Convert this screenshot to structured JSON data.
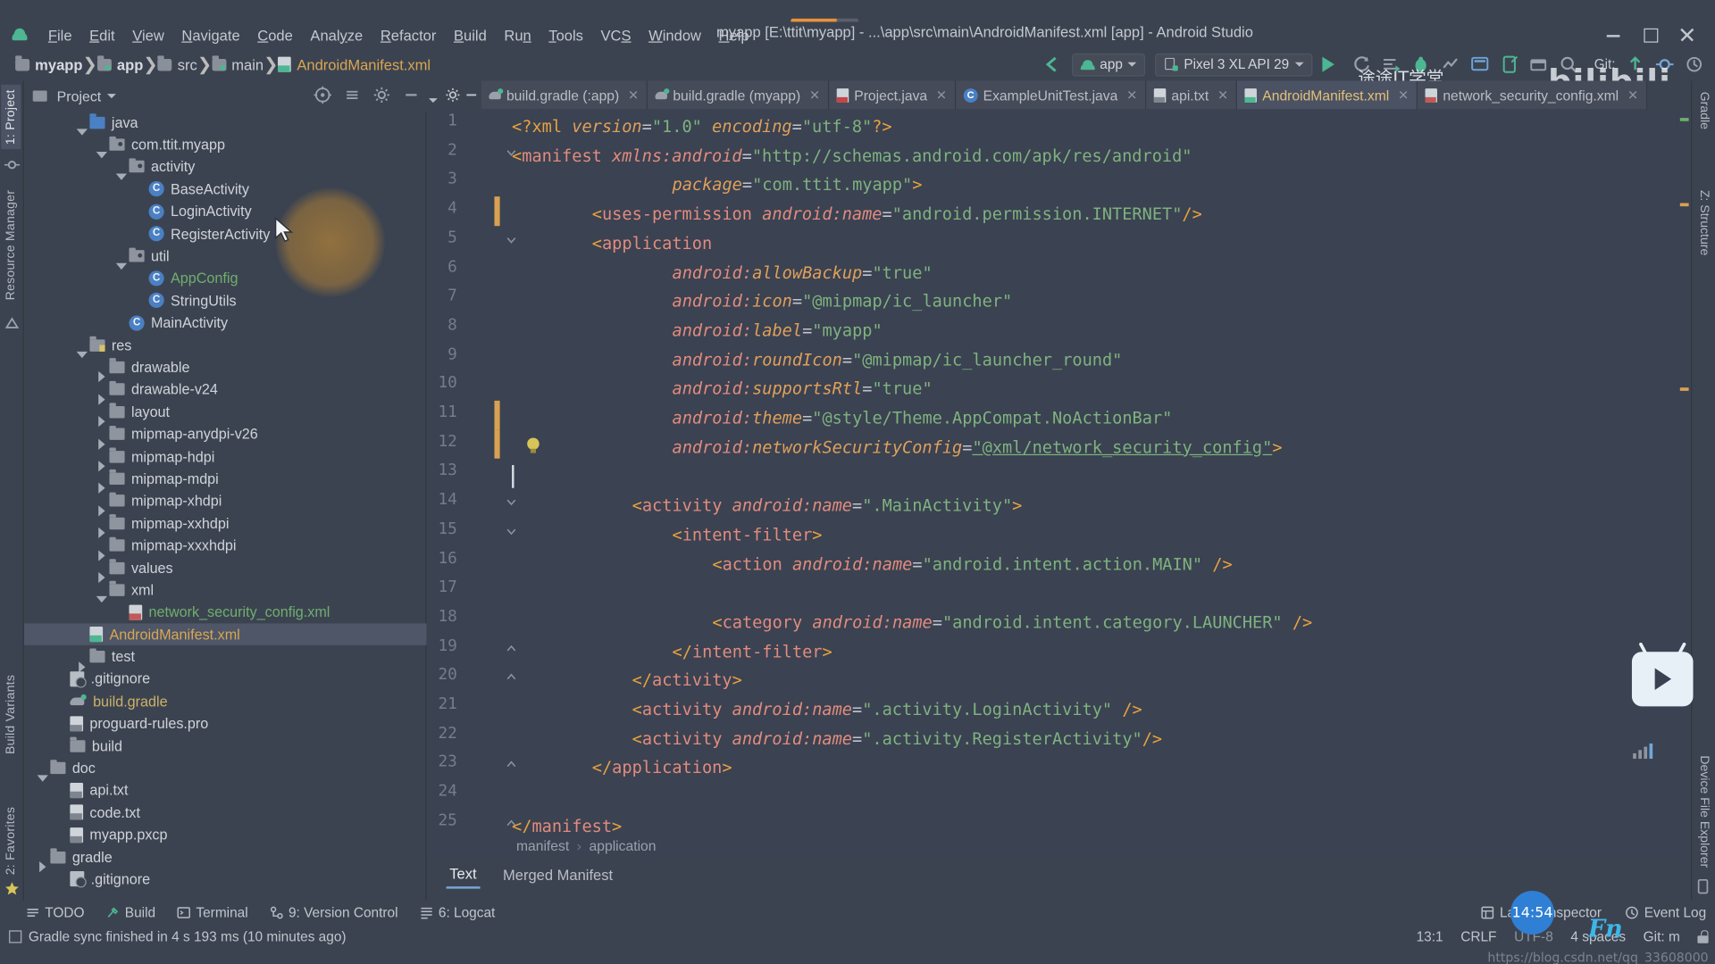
{
  "window": {
    "title": "myapp [E:\\ttit\\myapp] - ...\\app\\src\\main\\AndroidManifest.xml [app] - Android Studio",
    "minimize_label": "Minimize",
    "maximize_label": "Maximize",
    "close_label": "Close"
  },
  "menu": {
    "items": [
      {
        "label": "File"
      },
      {
        "label": "Edit"
      },
      {
        "label": "View"
      },
      {
        "label": "Navigate"
      },
      {
        "label": "Code"
      },
      {
        "label": "Analyze"
      },
      {
        "label": "Refactor"
      },
      {
        "label": "Build"
      },
      {
        "label": "Run"
      },
      {
        "label": "Tools"
      },
      {
        "label": "VCS"
      },
      {
        "label": "Window"
      },
      {
        "label": "Help"
      }
    ]
  },
  "navbar": {
    "crumbs": [
      "myapp",
      "app",
      "src",
      "main",
      "AndroidManifest.xml"
    ],
    "run_config": "app",
    "device": "Pixel 3 XL API 29",
    "git_label": "Git:"
  },
  "watermark": {
    "brand": "bilibili",
    "channel": "途途IT学堂",
    "blog": "https://blog.csdn.net/qq_33608000"
  },
  "left_strip": {
    "project_tab": "1: Project",
    "resource_manager": "Resource Manager",
    "structure": "2: Structure",
    "favorites": "2: Favorites",
    "build_variants": "Build Variants"
  },
  "right_strip": {
    "gradle": "Gradle",
    "structure": "Z: Structure",
    "device_file_explorer": "Device File Explorer"
  },
  "project_panel": {
    "title": "Project",
    "tree": [
      {
        "depth": 2,
        "arrow": "down",
        "icon": "folder-blue",
        "label": "java",
        "color": "white"
      },
      {
        "depth": 3,
        "arrow": "down",
        "icon": "package",
        "label": "com.ttit.myapp",
        "color": "white"
      },
      {
        "depth": 4,
        "arrow": "down",
        "icon": "package",
        "label": "activity",
        "color": "white"
      },
      {
        "depth": 5,
        "arrow": "none",
        "icon": "class",
        "label": "BaseActivity",
        "color": "white"
      },
      {
        "depth": 5,
        "arrow": "none",
        "icon": "class",
        "label": "LoginActivity",
        "color": "white"
      },
      {
        "depth": 5,
        "arrow": "none",
        "icon": "class",
        "label": "RegisterActivity",
        "color": "white"
      },
      {
        "depth": 4,
        "arrow": "down",
        "icon": "package",
        "label": "util",
        "color": "white"
      },
      {
        "depth": 5,
        "arrow": "none",
        "icon": "class",
        "label": "AppConfig",
        "color": "green"
      },
      {
        "depth": 5,
        "arrow": "none",
        "icon": "class",
        "label": "StringUtils",
        "color": "white"
      },
      {
        "depth": 4,
        "arrow": "none",
        "icon": "class",
        "label": "MainActivity",
        "color": "white"
      },
      {
        "depth": 2,
        "arrow": "down",
        "icon": "folder-res",
        "label": "res",
        "color": "white"
      },
      {
        "depth": 3,
        "arrow": "right",
        "icon": "folder",
        "label": "drawable",
        "color": "white"
      },
      {
        "depth": 3,
        "arrow": "right",
        "icon": "folder",
        "label": "drawable-v24",
        "color": "white"
      },
      {
        "depth": 3,
        "arrow": "right",
        "icon": "folder",
        "label": "layout",
        "color": "white"
      },
      {
        "depth": 3,
        "arrow": "right",
        "icon": "folder",
        "label": "mipmap-anydpi-v26",
        "color": "white"
      },
      {
        "depth": 3,
        "arrow": "right",
        "icon": "folder",
        "label": "mipmap-hdpi",
        "color": "white"
      },
      {
        "depth": 3,
        "arrow": "right",
        "icon": "folder",
        "label": "mipmap-mdpi",
        "color": "white"
      },
      {
        "depth": 3,
        "arrow": "right",
        "icon": "folder",
        "label": "mipmap-xhdpi",
        "color": "white"
      },
      {
        "depth": 3,
        "arrow": "right",
        "icon": "folder",
        "label": "mipmap-xxhdpi",
        "color": "white"
      },
      {
        "depth": 3,
        "arrow": "right",
        "icon": "folder",
        "label": "mipmap-xxxhdpi",
        "color": "white"
      },
      {
        "depth": 3,
        "arrow": "right",
        "icon": "folder",
        "label": "values",
        "color": "white"
      },
      {
        "depth": 3,
        "arrow": "down",
        "icon": "folder",
        "label": "xml",
        "color": "white"
      },
      {
        "depth": 4,
        "arrow": "none",
        "icon": "file-xml",
        "label": "network_security_config.xml",
        "color": "green"
      },
      {
        "depth": 2,
        "arrow": "none",
        "icon": "file-mf",
        "label": "AndroidManifest.xml",
        "color": "orange",
        "selected": true
      },
      {
        "depth": 2,
        "arrow": "right",
        "icon": "folder",
        "label": "test",
        "color": "white"
      },
      {
        "depth": 1,
        "arrow": "none",
        "icon": "gitignore",
        "label": ".gitignore",
        "color": "white"
      },
      {
        "depth": 1,
        "arrow": "none",
        "icon": "gradle",
        "label": "build.gradle",
        "color": "yellow"
      },
      {
        "depth": 1,
        "arrow": "none",
        "icon": "file-txt",
        "label": "proguard-rules.pro",
        "color": "white"
      },
      {
        "depth": 1,
        "arrow": "none",
        "icon": "folder",
        "label": "build",
        "color": "white"
      },
      {
        "depth": 0,
        "arrow": "down",
        "icon": "folder",
        "label": "doc",
        "color": "white"
      },
      {
        "depth": 1,
        "arrow": "none",
        "icon": "file-txt",
        "label": "api.txt",
        "color": "white"
      },
      {
        "depth": 1,
        "arrow": "none",
        "icon": "file-txt",
        "label": "code.txt",
        "color": "white"
      },
      {
        "depth": 1,
        "arrow": "none",
        "icon": "file-txt",
        "label": "myapp.pxcp",
        "color": "white"
      },
      {
        "depth": 0,
        "arrow": "right",
        "icon": "folder",
        "label": "gradle",
        "color": "white"
      },
      {
        "depth": 1,
        "arrow": "none",
        "icon": "gitignore",
        "label": ".gitignore",
        "color": "white"
      }
    ]
  },
  "editor_tabs": [
    {
      "label": "build.gradle (:app)",
      "icon": "gradle",
      "active": false,
      "closable": true
    },
    {
      "label": "build.gradle (myapp)",
      "icon": "gradle",
      "active": false,
      "closable": true
    },
    {
      "label": "Project.java",
      "icon": "java",
      "active": false,
      "closable": true
    },
    {
      "label": "ExampleUnitTest.java",
      "icon": "test",
      "active": false,
      "closable": true
    },
    {
      "label": "api.txt",
      "icon": "txt",
      "active": false,
      "closable": true
    },
    {
      "label": "AndroidManifest.xml",
      "icon": "mf",
      "active": true,
      "closable": true
    },
    {
      "label": "network_security_config.xml",
      "icon": "xmlred",
      "active": false,
      "closable": true
    }
  ],
  "editor": {
    "lines": [
      {
        "n": 1,
        "indent": 0,
        "tokens": [
          {
            "t": "tag",
            "v": "<?xml "
          },
          {
            "t": "attr",
            "v": "version"
          },
          {
            "t": "eq",
            "v": "="
          },
          {
            "t": "str",
            "v": "\"1.0\""
          },
          {
            "t": "plain",
            "v": " "
          },
          {
            "t": "attr",
            "v": "encoding"
          },
          {
            "t": "eq",
            "v": "="
          },
          {
            "t": "str",
            "v": "\"utf-8\""
          },
          {
            "t": "tag",
            "v": "?>"
          }
        ]
      },
      {
        "n": 2,
        "indent": 0,
        "fold": "down",
        "tokens": [
          {
            "t": "tag",
            "v": "<"
          },
          {
            "t": "elem",
            "v": "manifest"
          },
          {
            "t": "plain",
            "v": " "
          },
          {
            "t": "ns",
            "v": "xmlns:android"
          },
          {
            "t": "eq",
            "v": "="
          },
          {
            "t": "str",
            "v": "\"http://schemas.android.com/apk/res/android\""
          }
        ]
      },
      {
        "n": 3,
        "indent": 4,
        "tokens": [
          {
            "t": "attr",
            "v": "package"
          },
          {
            "t": "eq",
            "v": "="
          },
          {
            "t": "str",
            "v": "\"com.ttit.myapp\""
          },
          {
            "t": "tag",
            "v": ">"
          }
        ]
      },
      {
        "n": 4,
        "indent": 2,
        "change": true,
        "tokens": [
          {
            "t": "tag",
            "v": "<"
          },
          {
            "t": "elem",
            "v": "uses-permission"
          },
          {
            "t": "plain",
            "v": " "
          },
          {
            "t": "ns",
            "v": "android:name"
          },
          {
            "t": "eq",
            "v": "="
          },
          {
            "t": "str",
            "v": "\"android.permission.INTERNET\""
          },
          {
            "t": "tag",
            "v": "/>"
          }
        ]
      },
      {
        "n": 5,
        "indent": 2,
        "fold": "down",
        "tokens": [
          {
            "t": "tag",
            "v": "<"
          },
          {
            "t": "elem",
            "v": "application"
          }
        ]
      },
      {
        "n": 6,
        "indent": 4,
        "tokens": [
          {
            "t": "ns",
            "v": "android:"
          },
          {
            "t": "attr",
            "v": "allowBackup"
          },
          {
            "t": "eq",
            "v": "="
          },
          {
            "t": "str",
            "v": "\"true\""
          }
        ]
      },
      {
        "n": 7,
        "indent": 4,
        "tokens": [
          {
            "t": "ns",
            "v": "android:"
          },
          {
            "t": "attr",
            "v": "icon"
          },
          {
            "t": "eq",
            "v": "="
          },
          {
            "t": "str",
            "v": "\"@mipmap/ic_launcher\""
          }
        ]
      },
      {
        "n": 8,
        "indent": 4,
        "tokens": [
          {
            "t": "ns",
            "v": "android:"
          },
          {
            "t": "attr",
            "v": "label"
          },
          {
            "t": "eq",
            "v": "="
          },
          {
            "t": "str",
            "v": "\"myapp\""
          }
        ]
      },
      {
        "n": 9,
        "indent": 4,
        "tokens": [
          {
            "t": "ns",
            "v": "android:"
          },
          {
            "t": "attr",
            "v": "roundIcon"
          },
          {
            "t": "eq",
            "v": "="
          },
          {
            "t": "str",
            "v": "\"@mipmap/ic_launcher_round\""
          }
        ]
      },
      {
        "n": 10,
        "indent": 4,
        "tokens": [
          {
            "t": "ns",
            "v": "android:"
          },
          {
            "t": "attr",
            "v": "supportsRtl"
          },
          {
            "t": "eq",
            "v": "="
          },
          {
            "t": "str",
            "v": "\"true\""
          }
        ]
      },
      {
        "n": 11,
        "indent": 4,
        "change": true,
        "tokens": [
          {
            "t": "ns",
            "v": "android:"
          },
          {
            "t": "attr",
            "v": "theme"
          },
          {
            "t": "eq",
            "v": "="
          },
          {
            "t": "str",
            "v": "\"@style/Theme.AppCompat.NoActionBar\""
          }
        ]
      },
      {
        "n": 12,
        "indent": 4,
        "change": true,
        "bulb": true,
        "tokens": [
          {
            "t": "ns",
            "v": "android:"
          },
          {
            "t": "attr",
            "v": "networkSecurityConfig"
          },
          {
            "t": "eq",
            "v": "="
          },
          {
            "t": "strul",
            "v": "\"@xml/network_security_config\""
          },
          {
            "t": "tag",
            "v": ">"
          }
        ]
      },
      {
        "n": 13,
        "indent": 0,
        "caret": true,
        "tokens": []
      },
      {
        "n": 14,
        "indent": 3,
        "fold": "down",
        "tokens": [
          {
            "t": "tag",
            "v": "<"
          },
          {
            "t": "elem",
            "v": "activity"
          },
          {
            "t": "plain",
            "v": " "
          },
          {
            "t": "ns",
            "v": "android:name"
          },
          {
            "t": "eq",
            "v": "="
          },
          {
            "t": "str",
            "v": "\".MainActivity\""
          },
          {
            "t": "tag",
            "v": ">"
          }
        ]
      },
      {
        "n": 15,
        "indent": 4,
        "fold": "down",
        "tokens": [
          {
            "t": "tag",
            "v": "<"
          },
          {
            "t": "elem",
            "v": "intent-filter"
          },
          {
            "t": "tag",
            "v": ">"
          }
        ]
      },
      {
        "n": 16,
        "indent": 5,
        "tokens": [
          {
            "t": "tag",
            "v": "<"
          },
          {
            "t": "elem",
            "v": "action"
          },
          {
            "t": "plain",
            "v": " "
          },
          {
            "t": "ns",
            "v": "android:name"
          },
          {
            "t": "eq",
            "v": "="
          },
          {
            "t": "str",
            "v": "\"android.intent.action.MAIN\""
          },
          {
            "t": "tag",
            "v": " />"
          }
        ]
      },
      {
        "n": 17,
        "indent": 0,
        "tokens": []
      },
      {
        "n": 18,
        "indent": 5,
        "tokens": [
          {
            "t": "tag",
            "v": "<"
          },
          {
            "t": "elem",
            "v": "category"
          },
          {
            "t": "plain",
            "v": " "
          },
          {
            "t": "ns",
            "v": "android:name"
          },
          {
            "t": "eq",
            "v": "="
          },
          {
            "t": "str",
            "v": "\"android.intent.category.LAUNCHER\""
          },
          {
            "t": "tag",
            "v": " />"
          }
        ]
      },
      {
        "n": 19,
        "indent": 4,
        "fold": "up",
        "tokens": [
          {
            "t": "tag",
            "v": "</"
          },
          {
            "t": "elem",
            "v": "intent-filter"
          },
          {
            "t": "tag",
            "v": ">"
          }
        ]
      },
      {
        "n": 20,
        "indent": 3,
        "fold": "up",
        "tokens": [
          {
            "t": "tag",
            "v": "</"
          },
          {
            "t": "elem",
            "v": "activity"
          },
          {
            "t": "tag",
            "v": ">"
          }
        ]
      },
      {
        "n": 21,
        "indent": 3,
        "tokens": [
          {
            "t": "tag",
            "v": "<"
          },
          {
            "t": "elem",
            "v": "activity"
          },
          {
            "t": "plain",
            "v": " "
          },
          {
            "t": "ns",
            "v": "android:name"
          },
          {
            "t": "eq",
            "v": "="
          },
          {
            "t": "str",
            "v": "\".activity.LoginActivity\""
          },
          {
            "t": "tag",
            "v": " />"
          }
        ]
      },
      {
        "n": 22,
        "indent": 3,
        "tokens": [
          {
            "t": "tag",
            "v": "<"
          },
          {
            "t": "elem",
            "v": "activity"
          },
          {
            "t": "plain",
            "v": " "
          },
          {
            "t": "ns",
            "v": "android:name"
          },
          {
            "t": "eq",
            "v": "="
          },
          {
            "t": "str",
            "v": "\".activity.RegisterActivity\""
          },
          {
            "t": "tag",
            "v": "/>"
          }
        ]
      },
      {
        "n": 23,
        "indent": 2,
        "fold": "up",
        "tokens": [
          {
            "t": "tag",
            "v": "</"
          },
          {
            "t": "elem",
            "v": "application"
          },
          {
            "t": "tag",
            "v": ">"
          }
        ]
      },
      {
        "n": 24,
        "indent": 0,
        "tokens": []
      },
      {
        "n": 25,
        "indent": 0,
        "fold": "up",
        "tokens": [
          {
            "t": "tag",
            "v": "</"
          },
          {
            "t": "elem",
            "v": "manifest"
          },
          {
            "t": "tag",
            "v": ">"
          }
        ]
      }
    ],
    "breadcrumb": [
      "manifest",
      "application"
    ],
    "bottom_tabs": [
      {
        "label": "Text",
        "active": true
      },
      {
        "label": "Merged Manifest",
        "active": false
      }
    ]
  },
  "bottom_bar": {
    "items": [
      {
        "label": "TODO",
        "icon": "todo-icon"
      },
      {
        "label": "Build",
        "icon": "build-icon"
      },
      {
        "label": "Terminal",
        "icon": "terminal-icon"
      },
      {
        "label": "9: Version Control",
        "icon": "vcs-icon"
      },
      {
        "label": "6: Logcat",
        "icon": "logcat-icon"
      }
    ],
    "right_items": [
      {
        "label": "Layout Inspector",
        "icon": "layout-inspector-icon"
      },
      {
        "label": "Event Log",
        "icon": "event-log-icon"
      }
    ]
  },
  "status_bar": {
    "message": "Gradle sync finished in 4 s 193 ms (10 minutes ago)",
    "caret_position": "13:1",
    "line_separator": "CRLF",
    "encoding": "UTF-8",
    "indent": "4 spaces",
    "git_branch": "Git: m"
  },
  "overlay": {
    "clock": "14:54",
    "fn_key": "Fn"
  },
  "colors": {
    "accent_orange": "#e8a33d",
    "string_green": "#7eb37e",
    "element_salmon": "#e28c7d",
    "selection_blue": "#4e5667",
    "editor_bg": "#3b4252",
    "chrome_bg": "#3c4350"
  }
}
